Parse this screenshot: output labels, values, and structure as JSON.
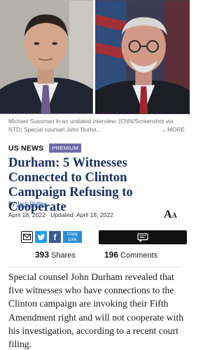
{
  "photo_caption": {
    "text": "Michael Sussman in an undated interview. (CNN/Screenshot via NTD) Special counsel John Durha…",
    "more_label": "MORE"
  },
  "section": {
    "label": "US NEWS",
    "badge": "PREMIUM"
  },
  "headline": "Durham: 5 Witnesses Connected to Clinton Campaign Refusing to Cooperate",
  "byline": {
    "prefix": "By",
    "author": "Jack Phillips"
  },
  "dates": "April 18, 2022   Updated: April 18, 2022",
  "share": {
    "copy_link_label": "Copy Link",
    "facebook_glyph": "f"
  },
  "stats": {
    "shares_count": "393",
    "shares_label": "Shares",
    "comments_count": "196",
    "comments_label": "Comments"
  },
  "body_paragraph": "Special counsel John Durham revealed that five witnesses who have connections to the Clinton campaign are invoking their Fifth Amendment right and will not cooperate with his investigation, according to a recent court filing.",
  "icons": {
    "email": "envelope-icon",
    "twitter": "twitter-bird-icon",
    "facebook": "facebook-f-icon",
    "comments": "chat-bubble-icon",
    "font_size": "font-size-icon",
    "more": "chevron-down-icon"
  },
  "colors": {
    "headline": "#1b2f62",
    "premium_badge": "#6c6aa8",
    "twitter": "#1d9bf0",
    "facebook": "#3b5998",
    "copy_link": "#2a8fd6",
    "author_link": "#1f4f9e"
  }
}
